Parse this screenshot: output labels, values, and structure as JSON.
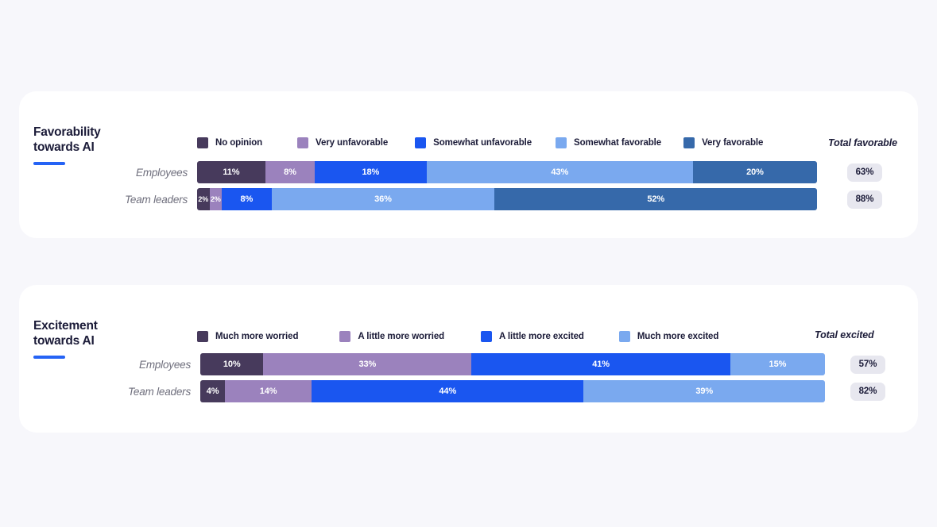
{
  "page": {
    "background": "#f7f7fb",
    "card_background": "#ffffff",
    "accent": "#2563f5",
    "badge_background": "#e7e7ef",
    "text_dark": "#1b1b38",
    "label_gray": "#6f6f7d"
  },
  "charts": [
    {
      "id": "favorability",
      "title_line1": "Favorability",
      "title_line2": "towards AI",
      "total_header": "Total favorable",
      "legend": [
        {
          "label": "No opinion",
          "color": "#473a5c"
        },
        {
          "label": "Very unfavorable",
          "color": "#9b82bd"
        },
        {
          "label": "Somewhat unfavorable",
          "color": "#1a56f0"
        },
        {
          "label": "Somewhat favorable",
          "color": "#7aa9ef"
        },
        {
          "label": "Very favorable",
          "color": "#3669aa"
        }
      ],
      "rows": [
        {
          "label": "Employees",
          "total": "63%",
          "segments": [
            {
              "label": "11%",
              "value": 11,
              "color": "#473a5c"
            },
            {
              "label": "8%",
              "value": 8,
              "color": "#9b82bd"
            },
            {
              "label": "18%",
              "value": 18,
              "color": "#1a56f0"
            },
            {
              "label": "43%",
              "value": 43,
              "color": "#7aa9ef"
            },
            {
              "label": "20%",
              "value": 20,
              "color": "#3669aa"
            }
          ]
        },
        {
          "label": "Team leaders",
          "total": "88%",
          "segments": [
            {
              "label": "2%",
              "value": 2,
              "color": "#473a5c",
              "tiny": true
            },
            {
              "label": "2%",
              "value": 2,
              "color": "#9b82bd",
              "tiny": true
            },
            {
              "label": "8%",
              "value": 8,
              "color": "#1a56f0"
            },
            {
              "label": "36%",
              "value": 36,
              "color": "#7aa9ef"
            },
            {
              "label": "52%",
              "value": 52,
              "color": "#3669aa"
            }
          ]
        }
      ]
    },
    {
      "id": "excitement",
      "title_line1": "Excitement",
      "title_line2": "towards AI",
      "total_header": "Total excited",
      "legend": [
        {
          "label": "Much more worried",
          "color": "#473a5c"
        },
        {
          "label": "A little more worried",
          "color": "#9b82bd"
        },
        {
          "label": "A little more excited",
          "color": "#1a56f0"
        },
        {
          "label": "Much more excited",
          "color": "#7aa9ef"
        }
      ],
      "rows": [
        {
          "label": "Employees",
          "total": "57%",
          "segments": [
            {
              "label": "10%",
              "value": 10,
              "color": "#473a5c"
            },
            {
              "label": "33%",
              "value": 33,
              "color": "#9b82bd"
            },
            {
              "label": "41%",
              "value": 41,
              "color": "#1a56f0"
            },
            {
              "label": "15%",
              "value": 15,
              "color": "#7aa9ef"
            }
          ]
        },
        {
          "label": "Team leaders",
          "total": "82%",
          "segments": [
            {
              "label": "4%",
              "value": 4,
              "color": "#473a5c"
            },
            {
              "label": "14%",
              "value": 14,
              "color": "#9b82bd"
            },
            {
              "label": "44%",
              "value": 44,
              "color": "#1a56f0"
            },
            {
              "label": "39%",
              "value": 39,
              "color": "#7aa9ef"
            }
          ]
        }
      ]
    }
  ],
  "chart_data": [
    {
      "type": "bar",
      "subtype": "stacked-horizontal-100",
      "title": "Favorability towards AI",
      "xlabel": "",
      "ylabel": "",
      "xlim": [
        0,
        100
      ],
      "grid": false,
      "legend_position": "top",
      "categories": [
        "Employees",
        "Team leaders"
      ],
      "series": [
        {
          "name": "No opinion",
          "values": [
            11,
            2
          ],
          "color": "#473a5c"
        },
        {
          "name": "Very unfavorable",
          "values": [
            8,
            2
          ],
          "color": "#9b82bd"
        },
        {
          "name": "Somewhat unfavorable",
          "values": [
            18,
            8
          ],
          "color": "#1a56f0"
        },
        {
          "name": "Somewhat favorable",
          "values": [
            43,
            36
          ],
          "color": "#7aa9ef"
        },
        {
          "name": "Very favorable",
          "values": [
            20,
            52
          ],
          "color": "#3669aa"
        }
      ],
      "annotations": {
        "Total favorable": {
          "Employees": 63,
          "Team leaders": 88
        }
      }
    },
    {
      "type": "bar",
      "subtype": "stacked-horizontal-100",
      "title": "Excitement towards AI",
      "xlabel": "",
      "ylabel": "",
      "xlim": [
        0,
        100
      ],
      "grid": false,
      "legend_position": "top",
      "categories": [
        "Employees",
        "Team leaders"
      ],
      "series": [
        {
          "name": "Much more worried",
          "values": [
            10,
            4
          ],
          "color": "#473a5c"
        },
        {
          "name": "A little more worried",
          "values": [
            33,
            14
          ],
          "color": "#9b82bd"
        },
        {
          "name": "A little more excited",
          "values": [
            41,
            44
          ],
          "color": "#1a56f0"
        },
        {
          "name": "Much more excited",
          "values": [
            15,
            39
          ],
          "color": "#7aa9ef"
        }
      ],
      "annotations": {
        "Total excited": {
          "Employees": 57,
          "Team leaders": 82
        }
      }
    }
  ]
}
